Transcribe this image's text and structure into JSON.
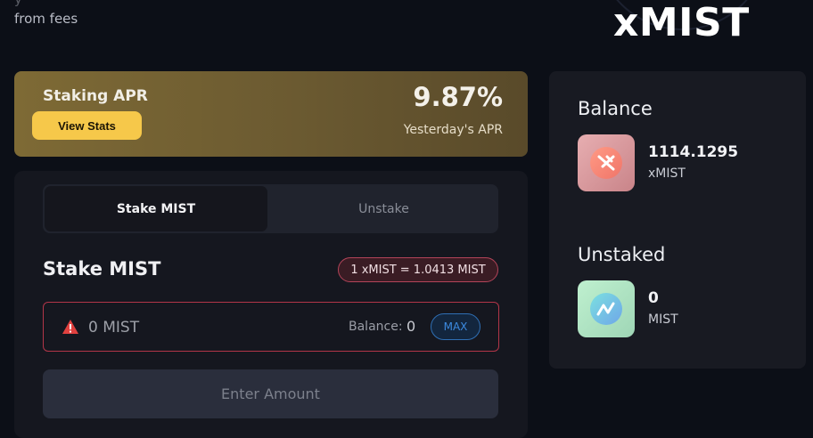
{
  "intro": {
    "line1": "y",
    "line2": "from fees"
  },
  "brand": {
    "logo_text": "xMIST"
  },
  "apr": {
    "title": "Staking APR",
    "view_stats": "View Stats",
    "value": "9.87%",
    "subtitle": "Yesterday's APR"
  },
  "stake": {
    "tabs": [
      {
        "label": "Stake MIST",
        "active": true
      },
      {
        "label": "Unstake",
        "active": false
      }
    ],
    "heading": "Stake MIST",
    "rate": "1 xMIST = 1.0413 MIST",
    "input_placeholder": "0 MIST",
    "balance_label": "Balance:",
    "balance_value": "0",
    "max_label": "MAX",
    "submit_label": "Enter Amount",
    "warning_icon": "warning-triangle-icon"
  },
  "side": {
    "balance_title": "Balance",
    "balance_value": "1114.1295",
    "balance_unit": "xMIST",
    "balance_icon": "xmist-token-icon",
    "unstaked_title": "Unstaked",
    "unstaked_value": "0",
    "unstaked_unit": "MIST",
    "unstaked_icon": "mist-token-icon"
  },
  "colors": {
    "accent_yellow": "#f6c84a",
    "error_red": "#b23548",
    "max_blue": "#3c8ae0"
  }
}
